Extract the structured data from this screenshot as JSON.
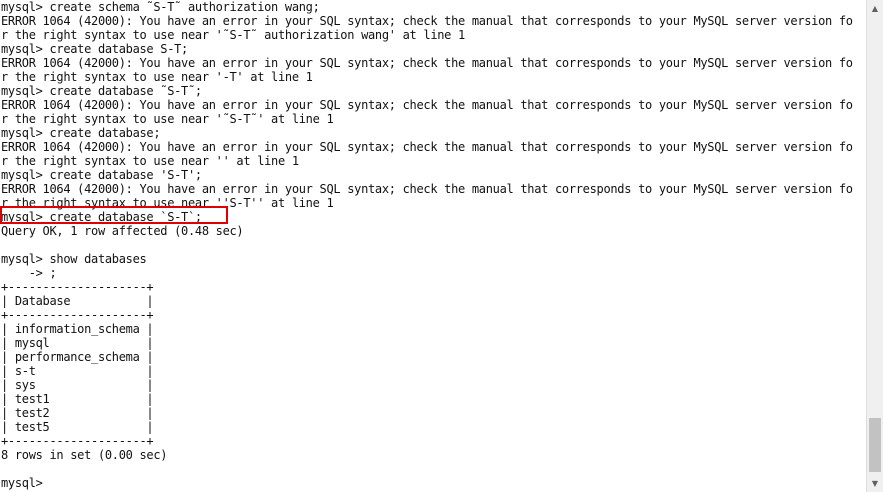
{
  "terminal": {
    "lines": [
      "mysql> create schema ˜S-T˜ authorization wang;",
      "ERROR 1064 (42000): You have an error in your SQL syntax; check the manual that corresponds to your MySQL server version fo",
      "r the right syntax to use near '˜S-T˜ authorization wang' at line 1",
      "mysql> create database S-T;",
      "ERROR 1064 (42000): You have an error in your SQL syntax; check the manual that corresponds to your MySQL server version fo",
      "r the right syntax to use near '-T' at line 1",
      "mysql> create database ˜S-T˜;",
      "ERROR 1064 (42000): You have an error in your SQL syntax; check the manual that corresponds to your MySQL server version fo",
      "r the right syntax to use near '˜S-T˜' at line 1",
      "mysql> create database;",
      "ERROR 1064 (42000): You have an error in your SQL syntax; check the manual that corresponds to your MySQL server version fo",
      "r the right syntax to use near '' at line 1",
      "mysql> create database 'S-T';",
      "ERROR 1064 (42000): You have an error in your SQL syntax; check the manual that corresponds to your MySQL server version fo",
      "r the right syntax to use near ''S-T'' at line 1",
      "mysql> create database `S-T`;",
      "Query OK, 1 row affected (0.48 sec)",
      "",
      "mysql> show databases",
      "    -> ;",
      "+--------------------+",
      "| Database           |",
      "+--------------------+",
      "| information_schema |",
      "| mysql              |",
      "| performance_schema |",
      "| s-t                |",
      "| sys                |",
      "| test1              |",
      "| test2              |",
      "| test5              |",
      "+--------------------+",
      "8 rows in set (0.00 sec)",
      "",
      "mysql>"
    ]
  },
  "scrollbar": {
    "up_arrow": "▲",
    "down_arrow": "▼"
  },
  "colors": {
    "text": "#111111",
    "background": "#ffffff",
    "highlight_border": "#e00000"
  }
}
